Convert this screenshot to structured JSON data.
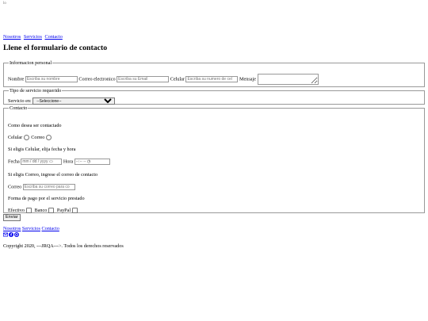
{
  "logo_alt": "lo",
  "nav": [
    {
      "label": "Nosotros"
    },
    {
      "label": "Servicios"
    },
    {
      "label": "Contacto"
    }
  ],
  "title": "Llene el formulario de contacto",
  "personal": {
    "legend": "Informacion personal",
    "nombre_label": "Nombre",
    "nombre_placeholder": "Escriba su nombre",
    "correo_label": "Correo electronico",
    "correo_placeholder": "Escriba su Email",
    "celular_label": "Celular",
    "celular_placeholder": "Escriba su numero de cel",
    "mensaje_label": "Mensaje"
  },
  "servicio": {
    "legend": "Tipo de servicio requerido",
    "label": "Servicio en:",
    "selected": "--Seleccione--"
  },
  "contacto": {
    "legend": "Contacto",
    "como": "Como desea ser contactado",
    "celular_label": "Celular",
    "correo_label": "Correo",
    "si_celular": "Si eligis Celular, elija fecha y hora",
    "fecha_label": "Fecha",
    "fecha_value": "mm / dd / yyyy",
    "hora_label": "Hora",
    "hora_value": "--:-- --",
    "si_correo": "Si eligis Correo, ingrese el correo de contacto",
    "correo_contacto_label": "Correo",
    "correo_contacto_placeholder": "Escriba su correo para co",
    "forma_pago": "Forma de pago por el servicio prestado",
    "efectivo_label": "Efectivo",
    "banco_label": "Banco",
    "paypal_label": "PayPal"
  },
  "enviar_label": "Enviar",
  "footer_nav": [
    {
      "label": "Nosotros"
    },
    {
      "label": "Servicios"
    },
    {
      "label": "Contacto"
    }
  ],
  "footer_icons": [
    "mail-icon",
    "facebook-icon",
    "whatsapp-icon"
  ],
  "copyright": "Copyright 2020, ---JRQA--->. Todos los derechos reservados",
  "colors": {
    "link": "#0000ee",
    "icon": "#0000ee"
  }
}
